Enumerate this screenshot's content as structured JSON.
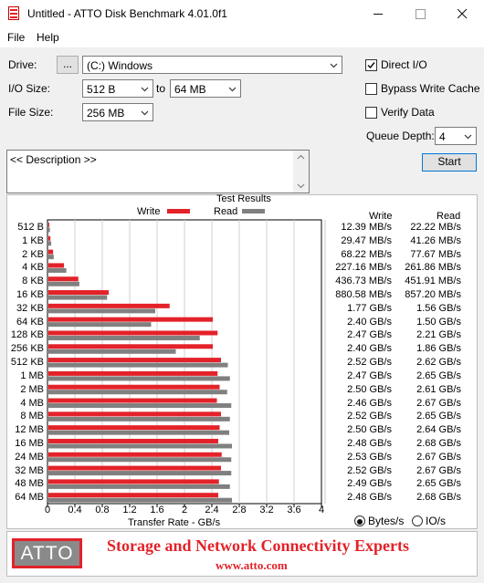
{
  "window": {
    "title": "Untitled - ATTO Disk Benchmark 4.01.0f1"
  },
  "menu": {
    "items": [
      "File",
      "Help"
    ]
  },
  "controls": {
    "drive_label": "Drive:",
    "browse_label": "...",
    "drive_value": "(C:) Windows",
    "io_size_label": "I/O Size:",
    "io_min": "512 B",
    "io_to": "to",
    "io_max": "64 MB",
    "file_size_label": "File Size:",
    "file_size": "256 MB",
    "direct_io_label": "Direct I/O",
    "direct_io_checked": true,
    "bypass_cache_label": "Bypass Write Cache",
    "bypass_cache_checked": false,
    "verify_label": "Verify Data",
    "verify_checked": false,
    "queue_depth_label": "Queue Depth:",
    "queue_depth": "4",
    "start_label": "Start",
    "description": "<< Description >>"
  },
  "results": {
    "title": "Test Results",
    "legend_write": "Write",
    "legend_read": "Read",
    "col_write": "Write",
    "col_read": "Read",
    "write_text": [
      "12.39 MB/s",
      "29.47 MB/s",
      "68.22 MB/s",
      "227.16 MB/s",
      "436.73 MB/s",
      "880.58 MB/s",
      "1.77 GB/s",
      "2.40 GB/s",
      "2.47 GB/s",
      "2.40 GB/s",
      "2.52 GB/s",
      "2.47 GB/s",
      "2.50 GB/s",
      "2.46 GB/s",
      "2.52 GB/s",
      "2.50 GB/s",
      "2.48 GB/s",
      "2.53 GB/s",
      "2.52 GB/s",
      "2.49 GB/s",
      "2.48 GB/s"
    ],
    "read_text": [
      "22.22 MB/s",
      "41.26 MB/s",
      "77.67 MB/s",
      "261.86 MB/s",
      "451.91 MB/s",
      "857.20 MB/s",
      "1.56 GB/s",
      "1.50 GB/s",
      "2.21 GB/s",
      "1.86 GB/s",
      "2.62 GB/s",
      "2.65 GB/s",
      "2.61 GB/s",
      "2.67 GB/s",
      "2.65 GB/s",
      "2.64 GB/s",
      "2.68 GB/s",
      "2.67 GB/s",
      "2.67 GB/s",
      "2.65 GB/s",
      "2.68 GB/s"
    ]
  },
  "chart_data": {
    "type": "bar",
    "orientation": "horizontal",
    "categories": [
      "512 B",
      "1 KB",
      "2 KB",
      "4 KB",
      "8 KB",
      "16 KB",
      "32 KB",
      "64 KB",
      "128 KB",
      "256 KB",
      "512 KB",
      "1 MB",
      "2 MB",
      "4 MB",
      "8 MB",
      "12 MB",
      "16 MB",
      "24 MB",
      "32 MB",
      "48 MB",
      "64 MB"
    ],
    "series": [
      {
        "name": "Write",
        "color": "#e32229",
        "values": [
          0.01239,
          0.02947,
          0.06822,
          0.22716,
          0.43673,
          0.88058,
          1.77,
          2.4,
          2.47,
          2.4,
          2.52,
          2.47,
          2.5,
          2.46,
          2.52,
          2.5,
          2.48,
          2.53,
          2.52,
          2.49,
          2.48
        ]
      },
      {
        "name": "Read",
        "color": "#808080",
        "values": [
          0.02222,
          0.04126,
          0.07767,
          0.26186,
          0.45191,
          0.8572,
          1.56,
          1.5,
          2.21,
          1.86,
          2.62,
          2.65,
          2.61,
          2.67,
          2.65,
          2.64,
          2.68,
          2.67,
          2.67,
          2.65,
          2.68
        ]
      }
    ],
    "xlabel": "Transfer Rate - GB/s",
    "xlim": [
      0,
      4
    ],
    "xticks": [
      "0",
      "0.4",
      "0.8",
      "1.2",
      "1.6",
      "2",
      "2.4",
      "2.8",
      "3.2",
      "3.6",
      "4"
    ],
    "grid": true
  },
  "units": {
    "bytes_label": "Bytes/s",
    "io_label": "IO/s",
    "selected": "bytes"
  },
  "banner": {
    "logo": "ATTO",
    "tagline": "Storage and Network Connectivity Experts",
    "website": "www.atto.com"
  }
}
